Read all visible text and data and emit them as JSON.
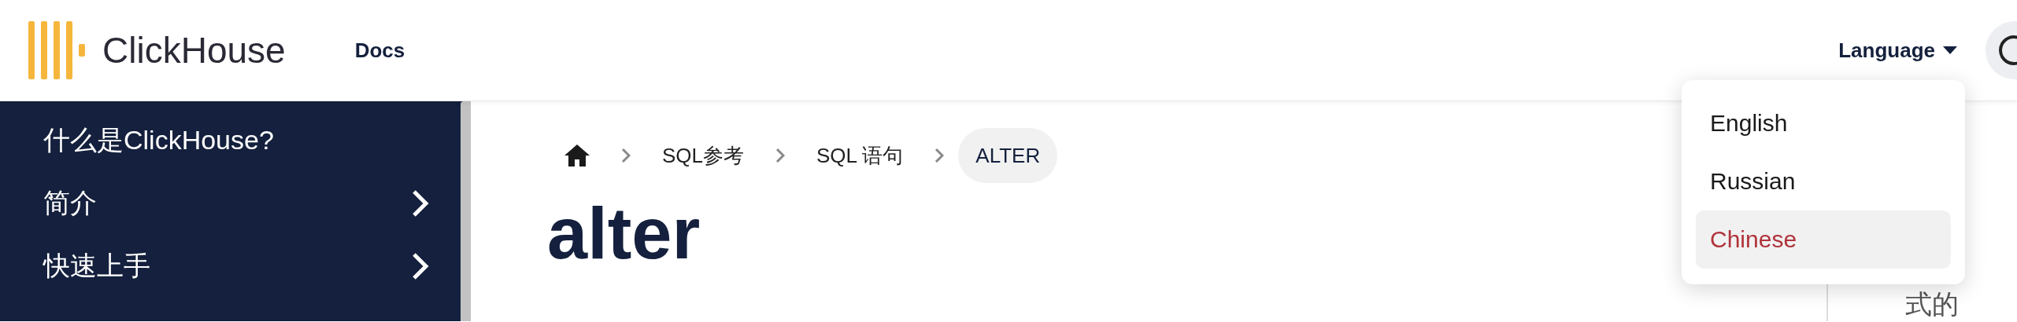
{
  "header": {
    "logo_text": "ClickHouse",
    "nav": [
      {
        "label": "Docs"
      }
    ],
    "language_button": "Language"
  },
  "sidebar": {
    "items": [
      {
        "label": "什么是ClickHouse?",
        "expandable": false
      },
      {
        "label": "简介",
        "expandable": true
      },
      {
        "label": "快速上手",
        "expandable": true
      }
    ]
  },
  "breadcrumb": [
    {
      "kind": "home",
      "selected": false
    },
    {
      "kind": "link",
      "label": "SQL参考",
      "selected": false
    },
    {
      "kind": "link",
      "label": "SQL 语句",
      "selected": false
    },
    {
      "kind": "link",
      "label": "ALTER",
      "selected": true
    }
  ],
  "page_title": "alter",
  "toc": {
    "text": "式的"
  },
  "language_menu": [
    {
      "label": "English",
      "selected": false
    },
    {
      "label": "Russian",
      "selected": false
    },
    {
      "label": "Chinese",
      "selected": true
    }
  ]
}
